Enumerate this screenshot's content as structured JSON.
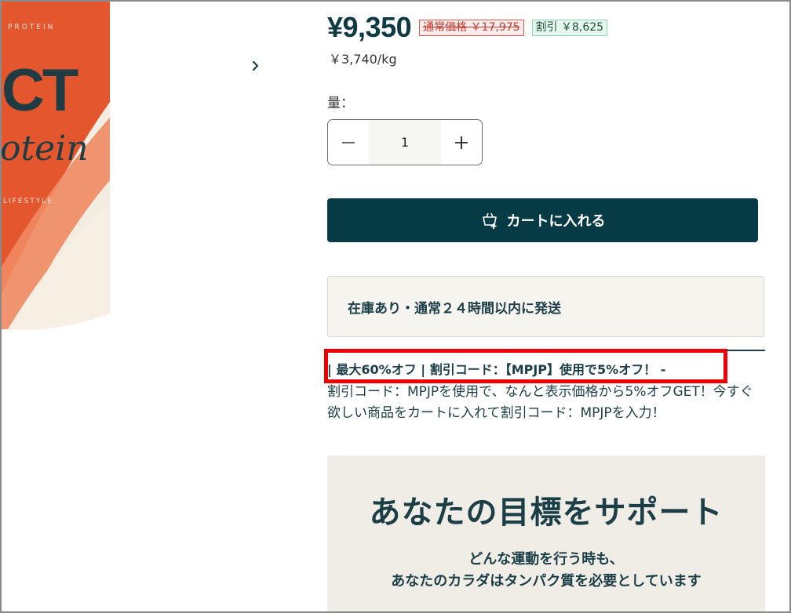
{
  "product_image": {
    "brand_text": "PROTEIN",
    "main_word": "CT",
    "script_word": "otein",
    "tagline": "LIFESTYLE",
    "next_icon": "chevron-right-icon"
  },
  "pricing": {
    "price": "¥9,350",
    "regular_price": "通常価格 ￥17,975",
    "discount": "割引 ￥8,625",
    "unit_price": "￥3,740/kg"
  },
  "quantity": {
    "label": "量：",
    "value": "1",
    "decrease_icon": "minus-icon",
    "increase_icon": "plus-icon"
  },
  "cart": {
    "label": "カートに入れる",
    "icon": "cart-add-icon"
  },
  "stock": {
    "text": "在庫あり・通常２４時間以内に発送"
  },
  "promo": {
    "title": "| 最大60%オフ | 割引コード：【MPJP】使用で5%オフ！ -",
    "body": "割引コード：MPJPを使用で、なんと表示価格から5%オフGET！今すぐ欲しい商品をカートに入れて割引コード：MPJPを入力！"
  },
  "banner": {
    "title": "あなたの目標をサポート",
    "subtitle_line1": "どんな運動を行う時も、",
    "subtitle_line2": "あなたのカラダはタンパク質を必要としています"
  },
  "colors": {
    "brand_dark": "#063a44",
    "accent_orange": "#e4572e",
    "highlight_red": "#ee0000"
  }
}
